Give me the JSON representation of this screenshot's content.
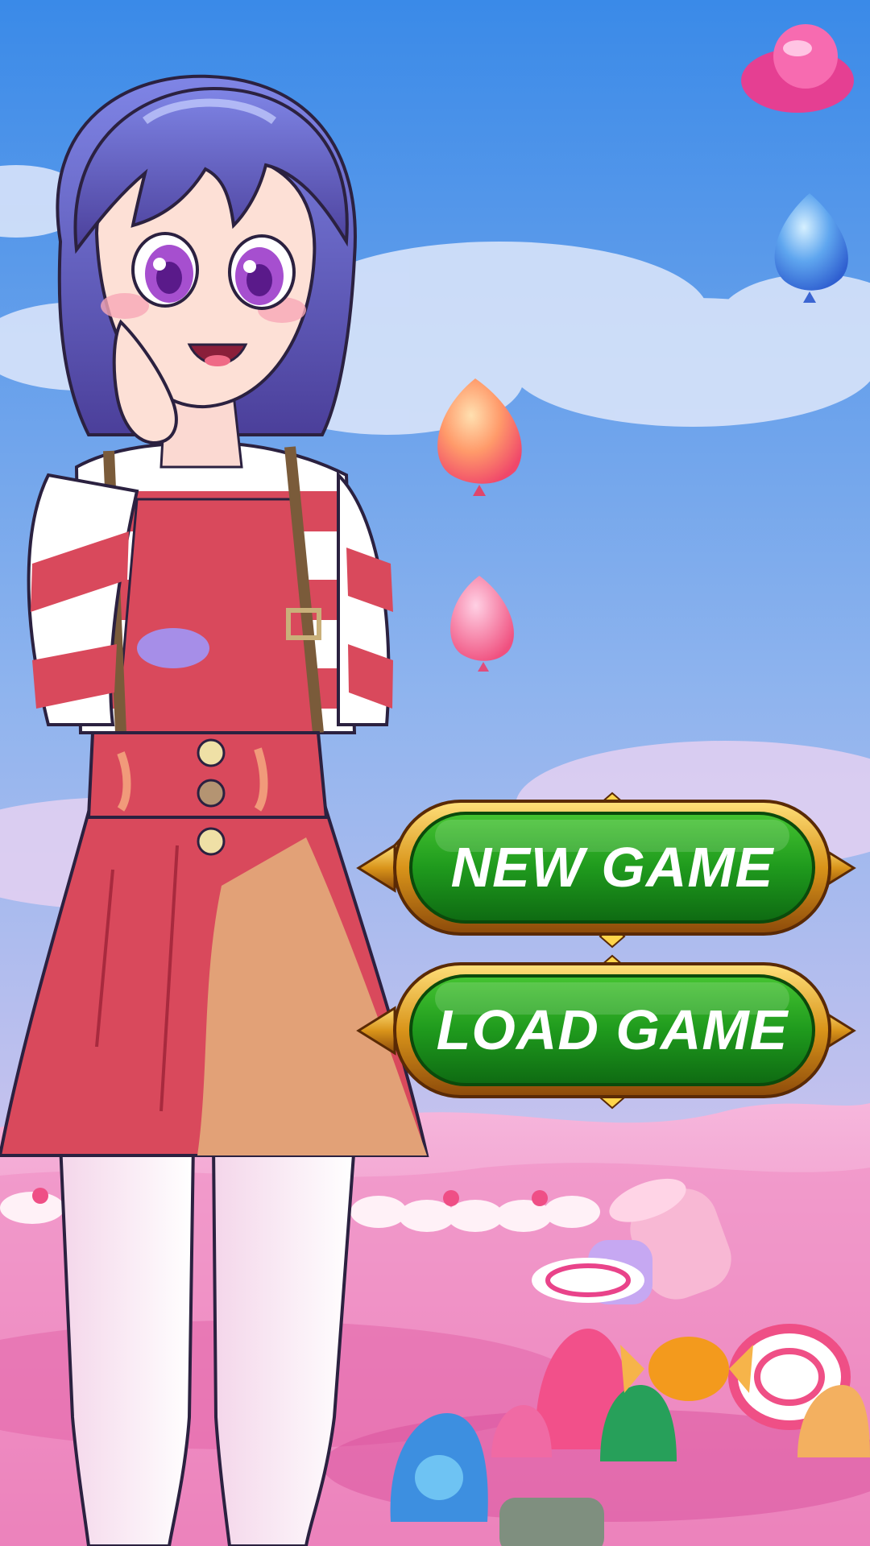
{
  "menu": {
    "new_game_label": "NEW GAME",
    "load_game_label": "LOAD GAME"
  },
  "scene": {
    "sky_top_color": "#3b8ee8",
    "sky_bottom_color": "#c9c6ef",
    "candy_ground_color": "#f3a8d4",
    "button_green": "#1a8a1a",
    "button_gold": "#e0a51e"
  }
}
